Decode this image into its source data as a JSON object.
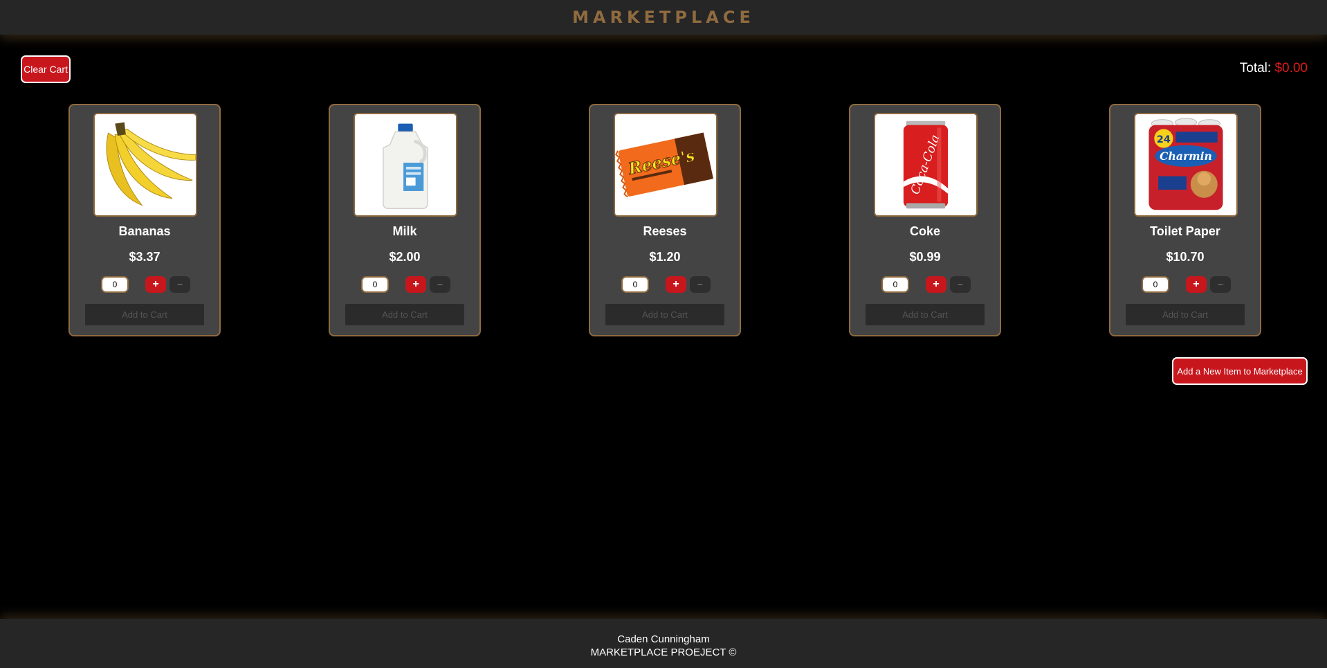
{
  "header": {
    "title": "MARKETPLACE"
  },
  "toolbar": {
    "clear_cart_label": "Clear Cart"
  },
  "cart": {
    "total_label": "Total:",
    "total_value": "$0.00"
  },
  "products": [
    {
      "name": "Bananas",
      "price": "$3.37",
      "quantity": "0",
      "image": "bananas-image"
    },
    {
      "name": "Milk",
      "price": "$2.00",
      "quantity": "0",
      "image": "milk-jug-image"
    },
    {
      "name": "Reeses",
      "price": "$1.20",
      "quantity": "0",
      "image": "reeses-package-image"
    },
    {
      "name": "Coke",
      "price": "$0.99",
      "quantity": "0",
      "image": "coke-can-image"
    },
    {
      "name": "Toilet Paper",
      "price": "$10.70",
      "quantity": "0",
      "image": "toilet-paper-pack-image"
    }
  ],
  "controls": {
    "plus": "+",
    "minus": "−",
    "add_to_cart": "Add to Cart"
  },
  "new_item_label": "Add a New Item to Marketplace",
  "footer": {
    "author": "Caden Cunningham",
    "project": "MARKETPLACE PROEJECT ©"
  },
  "colors": {
    "accent_gold": "#8f6b3f",
    "button_red": "#c8161d",
    "total_red": "#e01b1b",
    "card_bg": "#444444"
  }
}
